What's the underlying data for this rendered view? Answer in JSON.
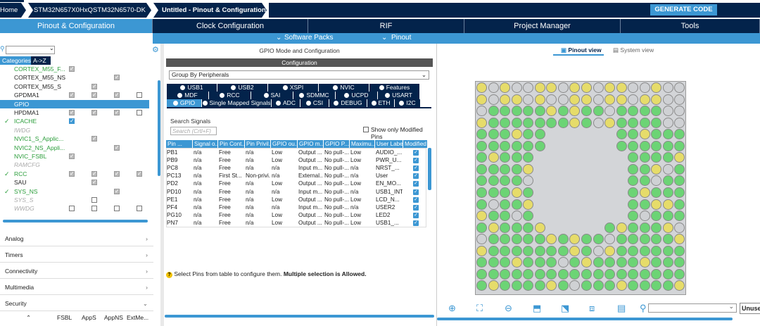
{
  "breadcrumb": [
    "Home",
    "STM32N657X0HxQ",
    "STM32N6570-DK",
    "Untitled - Pinout & Configuration"
  ],
  "generate_button": "GENERATE CODE",
  "tabs": [
    "Pinout & Configuration",
    "Clock Configuration",
    "RIF",
    "Project Manager",
    "Tools"
  ],
  "subtabs": [
    "Software Packs",
    "Pinout"
  ],
  "left": {
    "search_placeholder": "",
    "category_tabs": [
      "Categories",
      "A->Z"
    ],
    "items": [
      "CORTEX_M55_F...",
      "CORTEX_M55_NS",
      "CORTEX_M55_S",
      "GPDMA1",
      "GPIO",
      "HPDMA1",
      "ICACHE",
      "IWDG",
      "NVIC1_S_Applic...",
      "NVIC2_NS_Appli...",
      "NVIC_FSBL",
      "RAMCFG",
      "RCC",
      "SAU",
      "SYS_NS",
      "SYS_S",
      "WWDG"
    ],
    "sections": [
      "Analog",
      "Timers",
      "Connectivity",
      "Multimedia",
      "Security"
    ],
    "bottom_cols": [
      "FSBL",
      "AppS",
      "AppNS",
      "ExtMe..."
    ]
  },
  "middle": {
    "title": "GPIO Mode and Configuration",
    "config_header": "Configuration",
    "group_by": "Group By Peripherals",
    "peripheral_tabs_row1": [
      "USB1",
      "USB2",
      "XSPI",
      "NVIC",
      "Features"
    ],
    "peripheral_tabs_row2": [
      "MDF",
      "RCC",
      "SAI",
      "SDMMC",
      "UCPD",
      "USART"
    ],
    "peripheral_tabs_row3": [
      "GPIO",
      "Single Mapped Signals",
      "ADC",
      "CSI",
      "DEBUG",
      "ETH",
      "I2C"
    ],
    "search_label": "Search Signals",
    "search_placeholder": "Search (Crtl+F)",
    "show_modified": "Show only Modified Pins",
    "columns": [
      "Pin ...",
      "Signal o...",
      "Pin Cont...",
      "Pin Privil...",
      "GPIO ou...",
      "GPIO m...",
      "GPIO P...",
      "Maximu...",
      "User Label",
      "Modified"
    ],
    "rows": [
      [
        "PB1",
        "n/a",
        "Free",
        "n/a",
        "Low",
        "Output ...",
        "No pull-...",
        "Low",
        "AUDIO_..."
      ],
      [
        "PB9",
        "n/a",
        "Free",
        "n/a",
        "Low",
        "Output ...",
        "No pull-...",
        "Low",
        "PWR_U..."
      ],
      [
        "PC8",
        "n/a",
        "Free",
        "n/a",
        "n/a",
        "Input m...",
        "No pull-...",
        "n/a",
        "NRST_..."
      ],
      [
        "PC13",
        "n/a",
        "First St...",
        "Non-privi...",
        "n/a",
        "External...",
        "No pull-...",
        "n/a",
        "User"
      ],
      [
        "PD2",
        "n/a",
        "Free",
        "n/a",
        "Low",
        "Output ...",
        "No pull-...",
        "Low",
        "EN_MO..."
      ],
      [
        "PD10",
        "n/a",
        "Free",
        "n/a",
        "n/a",
        "Input m...",
        "No pull-...",
        "n/a",
        "USB1_INT"
      ],
      [
        "PE1",
        "n/a",
        "Free",
        "n/a",
        "Low",
        "Output ...",
        "No pull-...",
        "Low",
        "LCD_N..."
      ],
      [
        "PF4",
        "n/a",
        "Free",
        "n/a",
        "n/a",
        "Input m...",
        "No pull-...",
        "n/a",
        "USER2"
      ],
      [
        "PG10",
        "n/a",
        "Free",
        "n/a",
        "Low",
        "Output ...",
        "No pull-...",
        "Low",
        "LED2"
      ],
      [
        "PN7",
        "n/a",
        "Free",
        "n/a",
        "Low",
        "Output ...",
        "No pull-...",
        "Low",
        "USB1_..."
      ]
    ],
    "hint_prefix": "Select Pins from table to configure them.",
    "hint_bold": "Multiple selection is Allowed."
  },
  "right": {
    "view_tabs": [
      "Pinout view",
      "System view"
    ],
    "unused_label": "Unuse"
  }
}
